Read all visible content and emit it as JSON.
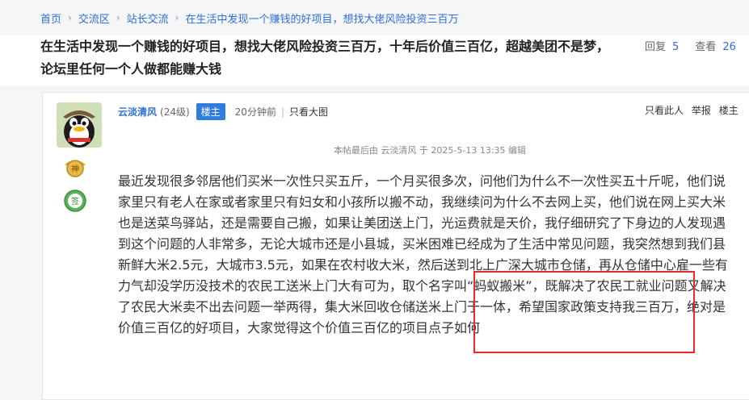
{
  "breadcrumb": {
    "items": [
      "首页",
      "交流区",
      "站长交流",
      "在生活中发现一个赚钱的好项目，想找大佬风险投资三百万"
    ]
  },
  "thread": {
    "title": "在生活中发现一个赚钱的好项目，想找大佬风险投资三百万，十年后价值三百亿，超越美团不是梦，论坛里任何一个人做都能赚大钱",
    "reply_label": "回复",
    "reply_count": "5",
    "view_label": "查看",
    "view_count": "26"
  },
  "post": {
    "author": "云淡清风",
    "level": "(24级)",
    "host_badge": "楼主",
    "time": "20分钟前",
    "view_image": "只看大图",
    "actions": [
      "只看此人",
      "举报",
      "楼主"
    ],
    "medals": [
      "神",
      "签"
    ],
    "edit_note": "本帖最后由 云淡清风 于 2025-5-13 13:35 编辑",
    "body": "最近发现很多邻居他们买米一次性只买五斤，一个月买很多次，问他们为什么不一次性买五十斤呢，他们说家里只有老人在家或者家里只有妇女和小孩所以搬不动，我继续问为什么不去网上买，他们说在网上买大米也是送菜鸟驿站，还是需要自己搬，如果让美团送上门，光运费就是天价，我仔细研究了下身边的人发现遇到这个问题的人非常多，无论大城市还是小县城，买米困难已经成为了生活中常见问题，我突然想到我们县新鲜大米2.5元，大城市3.5元，如果在农村收大米，然后送到北上广深大城市仓储，再从仓储中心雇一些有力气却没学历没技术的农民工送米上门大有可为，取个名字叫“蚂蚁搬米”，既解决了农民工就业问题又解决了农民大米卖不出去问题一举两得，集大米回收仓储送米上门于一体，希望国家政策支持我三百万，绝对是价值三百亿的好项目，大家觉得这个价值三百亿的项目点子如何"
  },
  "colors": {
    "link": "#2f6fd6",
    "badge": "#2f7de1",
    "highlight": "#e52b2b"
  }
}
